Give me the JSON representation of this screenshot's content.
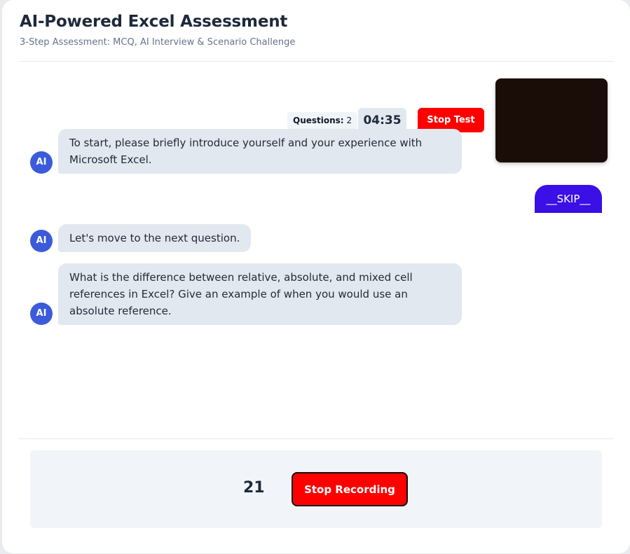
{
  "header": {
    "title": "AI-Powered Excel Assessment",
    "subtitle": "3-Step Assessment: MCQ, AI Interview & Scenario Challenge"
  },
  "controls": {
    "questions_label": "Questions:",
    "questions_count": "2",
    "timer": "04:35",
    "stop_test_label": "Stop Test"
  },
  "chat": {
    "ai_avatar_label": "AI",
    "messages": [
      {
        "role": "ai",
        "text": "To start, please briefly introduce yourself and your experience with Microsoft Excel."
      },
      {
        "role": "user",
        "text": "__SKIP__"
      },
      {
        "role": "ai",
        "text": "Let's move to the next question."
      },
      {
        "role": "ai",
        "text": "What is the difference between relative, absolute, and mixed cell references in Excel? Give an example of when you would use an absolute reference."
      }
    ]
  },
  "recording": {
    "counter": "21",
    "stop_recording_label": "Stop Recording"
  },
  "colors": {
    "accent_red": "#ff0000",
    "user_bubble": "#3b0fe6",
    "ai_avatar": "#3b5bdb",
    "ai_bubble": "#e2e8f0"
  }
}
